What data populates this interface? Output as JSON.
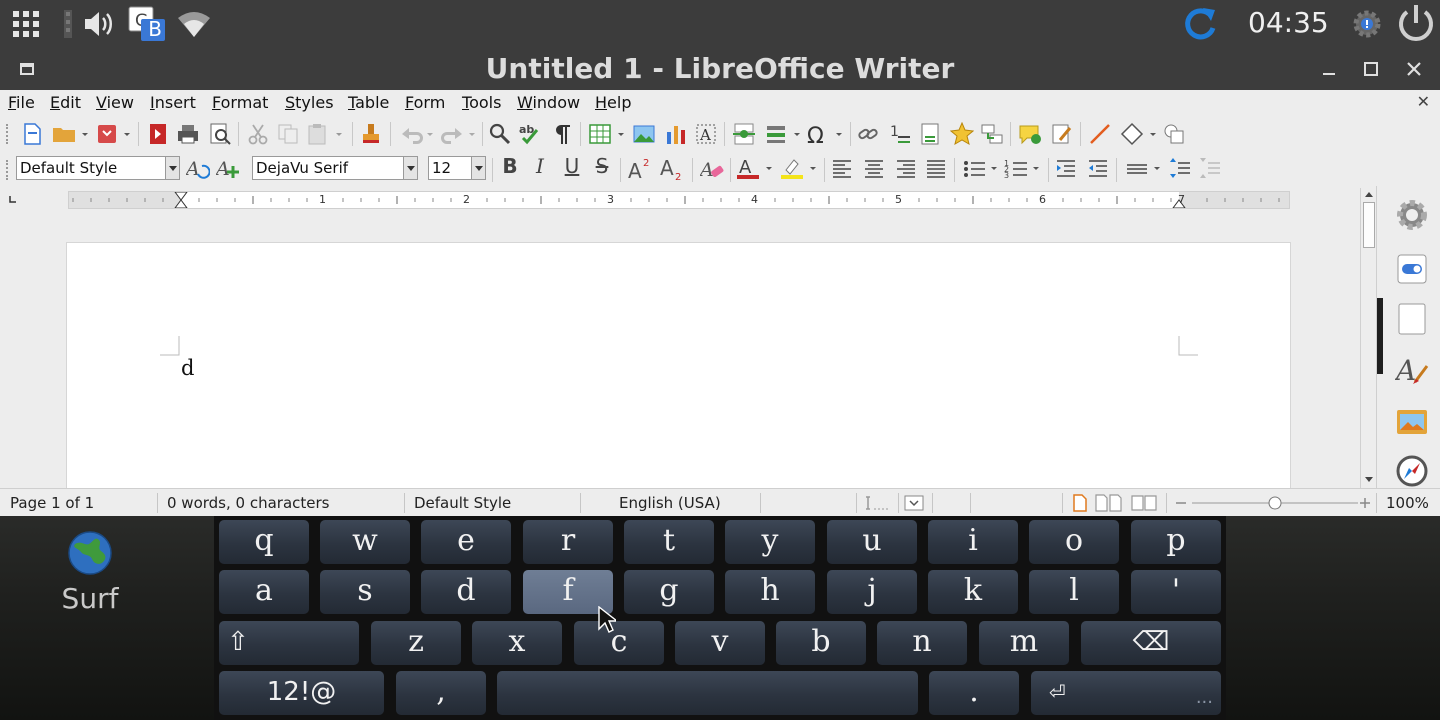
{
  "system_bar": {
    "clock": "04:35",
    "badge_letter": "B",
    "icons": [
      "apps-grid-icon",
      "mixer-icon",
      "volume-icon",
      "input-method-icon",
      "wifi-icon",
      "sync-icon",
      "alert-settings-icon",
      "power-icon"
    ]
  },
  "window": {
    "title": "Untitled 1 - LibreOffice Writer"
  },
  "menu": {
    "items": [
      "File",
      "Edit",
      "View",
      "Insert",
      "Format",
      "Styles",
      "Table",
      "Form",
      "Tools",
      "Window",
      "Help"
    ],
    "close_symbol": "✕"
  },
  "formatting": {
    "paragraph_style": "Default Style",
    "font_name": "DejaVu Serif",
    "font_size": "12"
  },
  "ruler": {
    "numbers": [
      "1",
      "2",
      "3",
      "4",
      "5",
      "6",
      "7"
    ]
  },
  "document": {
    "text": "d"
  },
  "status_bar": {
    "page": "Page 1 of 1",
    "word_count": "0 words, 0 characters",
    "page_style": "Default Style",
    "language": "English (USA)",
    "zoom": "100%",
    "zoom_slider_value": 0.5
  },
  "desktop": {
    "app_label": "Surf"
  },
  "keyboard": {
    "row1": [
      "q",
      "w",
      "e",
      "r",
      "t",
      "y",
      "u",
      "i",
      "o",
      "p"
    ],
    "row2": [
      "a",
      "s",
      "d",
      "f",
      "g",
      "h",
      "j",
      "k",
      "l",
      "'"
    ],
    "row3": [
      "z",
      "x",
      "c",
      "v",
      "b",
      "n",
      "m"
    ],
    "shift": "⇧",
    "backspace": "⌫",
    "symbols": "12!@",
    "comma": ",",
    "period": ".",
    "enter": "⏎",
    "more": "...",
    "active_key": "f"
  },
  "colors": {
    "chrome_dark": "#3c3c3c",
    "toolbar_bg": "#ededed",
    "accent_blue": "#1e7bd6",
    "font_color_red": "#c62828",
    "highlight_yellow": "#f4e41a",
    "key_bg": "#2c3440",
    "key_active": "#5a6880"
  }
}
